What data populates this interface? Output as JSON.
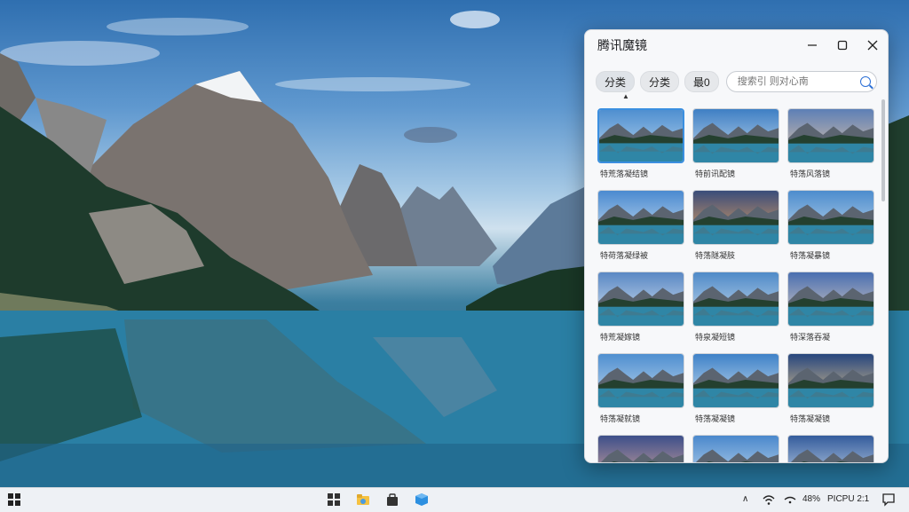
{
  "window": {
    "title": "腾讯魔镜",
    "minimize_icon": "minimize-icon",
    "maximize_icon": "maximize-icon",
    "close_icon": "close-icon"
  },
  "toolbar": {
    "chips": [
      "分类",
      "分类",
      "最0"
    ],
    "search_placeholder": "搜索引 则对心南"
  },
  "gallery": {
    "captions": [
      "特荒落凝结镜",
      "特前讯配镜",
      "特荡风落镜",
      "特荷落凝绿被",
      "特荡隧凝肢",
      "特荡凝暴镜",
      "特荒凝嫁镜",
      "特泉凝短镜",
      "特深落吞凝",
      "特荡凝就镜",
      "特荡凝凝镜",
      "特荡凝凝镜",
      "",
      "",
      ""
    ],
    "selected_index": 0
  },
  "taskbar": {
    "battery": "48%",
    "clock": "PICPU 2:1"
  },
  "colors": {
    "accent": "#3b8fe0",
    "taskbar": "#eef1f5"
  }
}
